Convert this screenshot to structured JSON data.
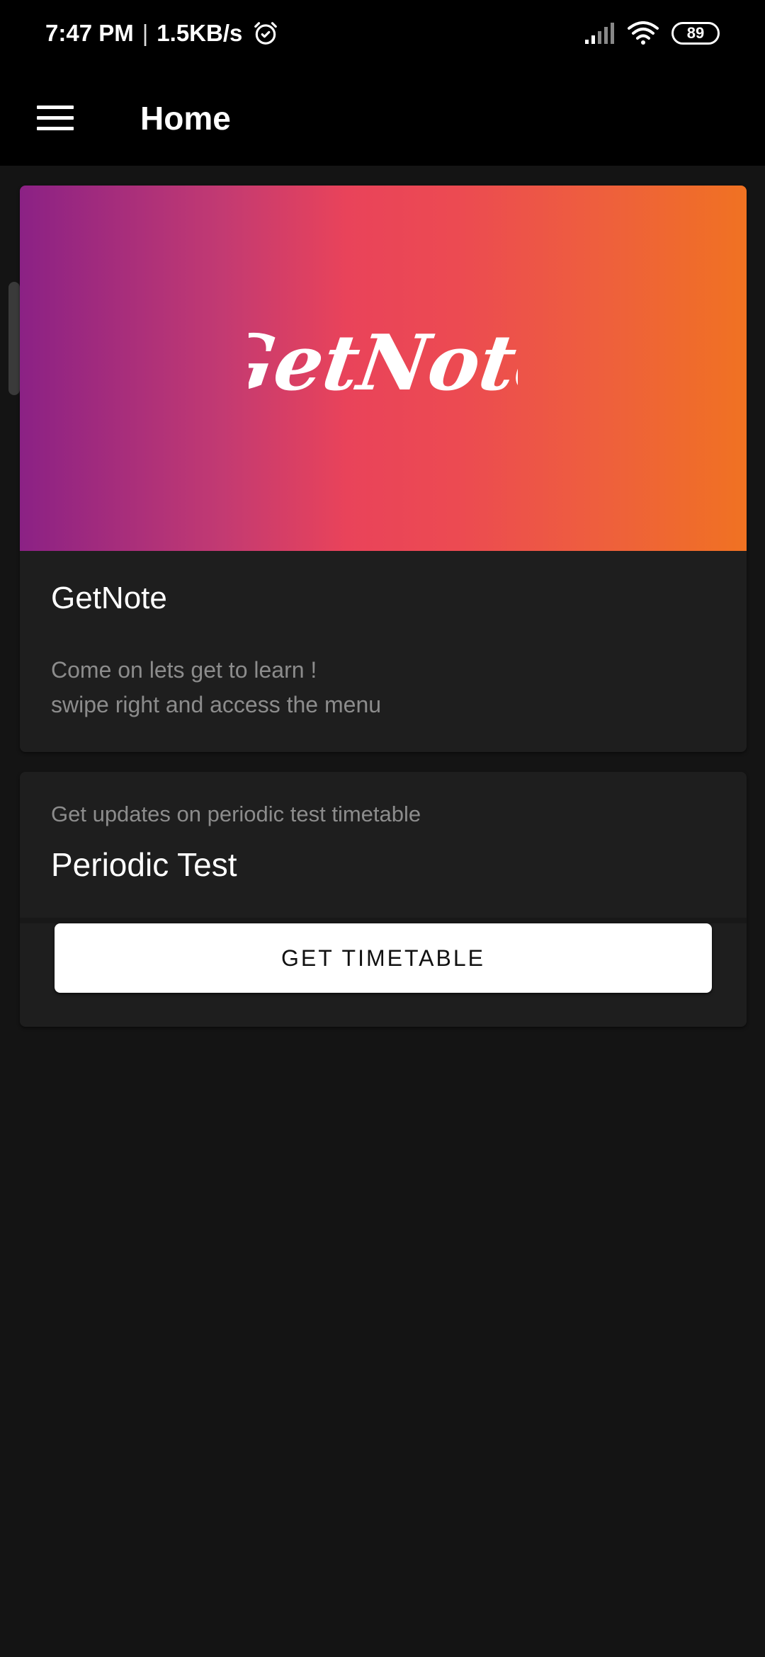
{
  "status_bar": {
    "time": "7:47 PM",
    "separator": "|",
    "network_speed": "1.5KB/s",
    "battery_level": "89",
    "icons": [
      "alarm-icon",
      "signal-icon",
      "wifi-icon",
      "battery-icon"
    ]
  },
  "app_bar": {
    "title": "Home",
    "menu_icon": "hamburger-menu-icon"
  },
  "hero_card": {
    "logo_text": "GetNote",
    "title": "GetNote",
    "description": "Come on lets get to learn !\nswipe right and access the menu",
    "gradient_colors": [
      "#8b2185",
      "#e9435a",
      "#f07222"
    ]
  },
  "periodic_card": {
    "subtitle": "Get updates on periodic test timetable",
    "title": "Periodic Test",
    "button_label": "GET TIMETABLE"
  },
  "colors": {
    "background": "#141414",
    "card": "#1e1e1e",
    "bar": "#000000",
    "muted_text": "#8c8c8c"
  }
}
